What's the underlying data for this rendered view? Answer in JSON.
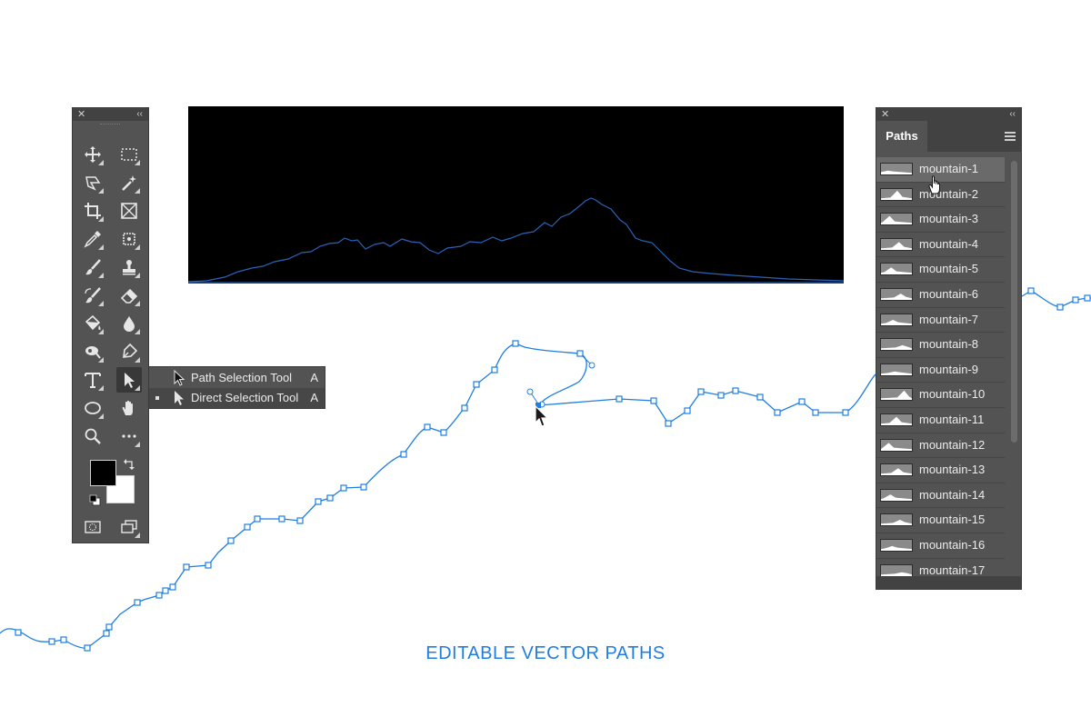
{
  "tools_panel": {
    "close_icon": "close-icon",
    "collapse_icon": "double-chevron-icon",
    "tools": [
      "move-tool",
      "rectangular-marquee-tool",
      "lasso-tool",
      "magic-wand-tool",
      "crop-tool",
      "frame-tool",
      "eyedropper-tool",
      "patch-tool",
      "brush-tool",
      "clone-stamp-tool",
      "history-brush-tool",
      "eraser-tool",
      "paint-bucket-tool",
      "blur-tool",
      "dodge-tool",
      "pen-tool",
      "type-tool",
      "direct-selection-tool",
      "ellipse-tool",
      "hand-tool",
      "zoom-tool",
      "more-tools"
    ],
    "foreground_color": "#000000",
    "background_color": "#ffffff"
  },
  "flyout": {
    "items": [
      {
        "label": "Path Selection Tool",
        "shortcut": "A",
        "active": false
      },
      {
        "label": "Direct Selection Tool",
        "shortcut": "A",
        "active": true
      }
    ]
  },
  "paths_panel": {
    "tab_label": "Paths",
    "items": [
      "mountain-1",
      "mountain-2",
      "mountain-3",
      "mountain-4",
      "mountain-5",
      "mountain-6",
      "mountain-7",
      "mountain-8",
      "mountain-9",
      "mountain-10",
      "mountain-11",
      "mountain-12",
      "mountain-13",
      "mountain-14",
      "mountain-15",
      "mountain-16",
      "mountain-17"
    ],
    "selected": "mountain-1"
  },
  "caption": "EDITABLE VECTOR PATHS",
  "colors": {
    "path_blue": "#1f7ee0",
    "panel_bg": "#535353"
  }
}
